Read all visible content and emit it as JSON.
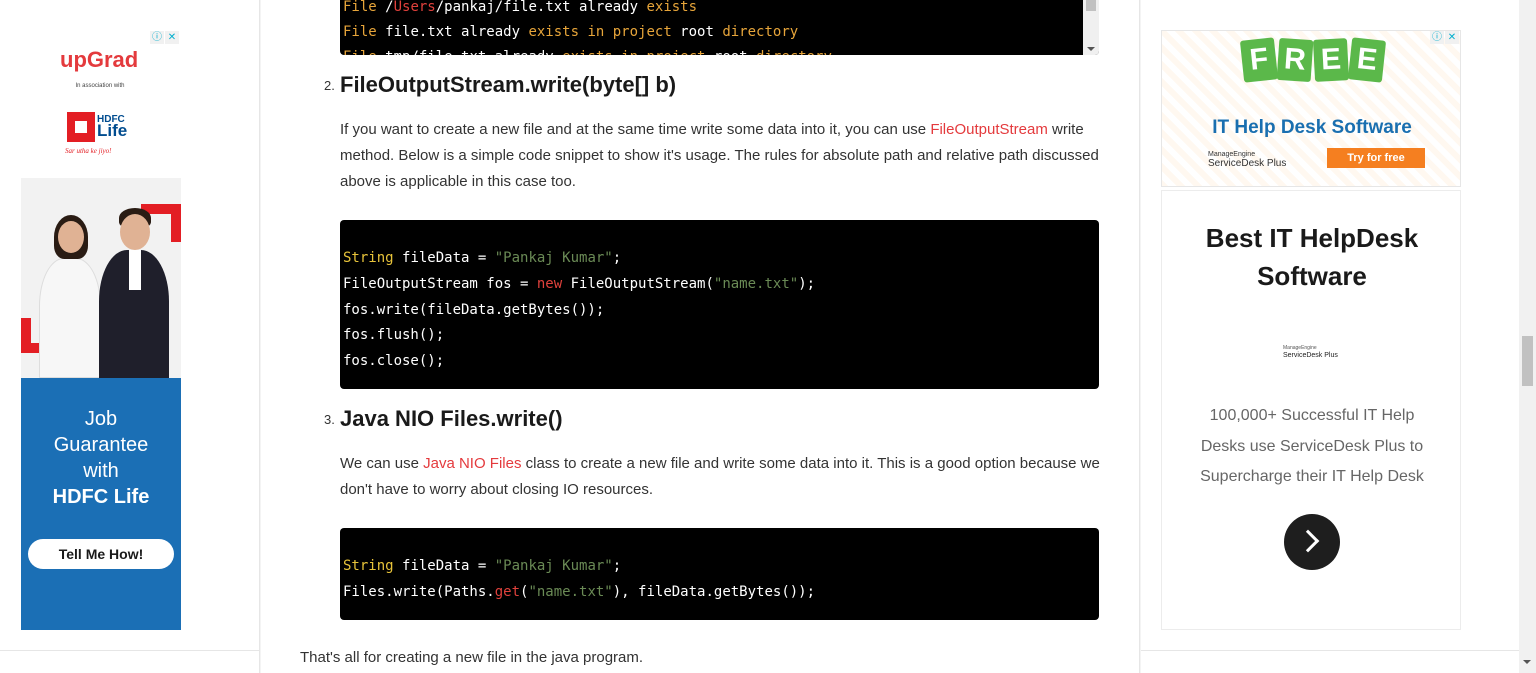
{
  "left_ad": {
    "ad_choices": [
      "ⓘ",
      "✕"
    ],
    "logo": "upGrad",
    "association": "In association with",
    "partner_line1": "HDFC",
    "partner_line2": "Life",
    "tagline": "Sar utha ke jiyo!",
    "banner_line1": "Job",
    "banner_line2": "Guarantee",
    "banner_line3": "with",
    "banner_line4": "HDFC Life",
    "cta": "Tell Me How!",
    "colors": {
      "banner": "#1b6fb5",
      "accent": "#e31e24"
    }
  },
  "article": {
    "code_top_lines": [
      {
        "segments": [
          [
            "File ",
            "k-orange"
          ],
          [
            "/",
            "plain"
          ],
          [
            "Users",
            "k-red"
          ],
          [
            "/pankaj/file.txt already ",
            "plain"
          ],
          [
            "exists",
            "k-orange"
          ]
        ]
      },
      {
        "segments": [
          [
            "File ",
            "k-orange"
          ],
          [
            "file.txt already ",
            "plain"
          ],
          [
            "exists in project ",
            "k-orange"
          ],
          [
            "root ",
            "plain"
          ],
          [
            "directory",
            "k-orange"
          ]
        ]
      },
      {
        "segments": [
          [
            "File ",
            "k-orange"
          ],
          [
            "tmp/file.txt already ",
            "plain"
          ],
          [
            "exists in project ",
            "k-orange"
          ],
          [
            "root ",
            "plain"
          ],
          [
            "directory",
            "k-orange"
          ]
        ]
      }
    ],
    "section2": {
      "number": "2.",
      "title": "FileOutputStream.write(byte[] b)",
      "para_before": "If you want to create a new file and at the same time write some data into it, you can use ",
      "link": "FileOutputStream",
      "para_after": " write method. Below is a simple code snippet to show it's usage. The rules for absolute path and relative path discussed above is applicable in this case too.",
      "code": [
        {
          "segments": [
            [
              "String ",
              "k-yellow"
            ],
            [
              "fileData = ",
              "plain"
            ],
            [
              "\"Pankaj Kumar\"",
              "k-green"
            ],
            [
              ";",
              "plain"
            ]
          ]
        },
        {
          "segments": [
            [
              "FileOutputStream fos = ",
              "plain"
            ],
            [
              "new ",
              "k-red"
            ],
            [
              "FileOutputStream(",
              "plain"
            ],
            [
              "\"name.txt\"",
              "k-green"
            ],
            [
              ");",
              "plain"
            ]
          ]
        },
        {
          "segments": [
            [
              "fos.write(fileData.getBytes());",
              "plain"
            ]
          ]
        },
        {
          "segments": [
            [
              "fos.flush();",
              "plain"
            ]
          ]
        },
        {
          "segments": [
            [
              "fos.close();",
              "plain"
            ]
          ]
        }
      ]
    },
    "section3": {
      "number": "3.",
      "title": "Java NIO Files.write()",
      "para_before": "We can use ",
      "link": "Java NIO Files",
      "para_after": " class to create a new file and write some data into it. This is a good option because we don't have to worry about closing IO resources.",
      "code": [
        {
          "segments": [
            [
              "String ",
              "k-yellow"
            ],
            [
              "fileData = ",
              "plain"
            ],
            [
              "\"Pankaj Kumar\"",
              "k-green"
            ],
            [
              ";",
              "plain"
            ]
          ]
        },
        {
          "segments": [
            [
              "Files.write(Paths.",
              "plain"
            ],
            [
              "get",
              "k-red"
            ],
            [
              "(",
              "plain"
            ],
            [
              "\"name.txt\"",
              "k-green"
            ],
            [
              "), fileData.getBytes());",
              "plain"
            ]
          ]
        }
      ]
    },
    "closing": "That's all for creating a new file in the java program."
  },
  "right_ad": {
    "ad_choices": [
      "ⓘ",
      "✕"
    ],
    "free_letters": [
      "F",
      "R",
      "E",
      "E"
    ],
    "banner_title": "IT Help Desk Software",
    "brand_small": "ManageEngine",
    "brand_big": "ServiceDesk Plus",
    "try_button": "Try for free",
    "card_title_line1": "Best IT HelpDesk",
    "card_title_line2": "Software",
    "card_logo_small": "ManageEngine",
    "card_logo_big": "ServiceDesk Plus",
    "card_desc": "100,000+ Successful IT Help Desks use ServiceDesk Plus to Supercharge their IT Help Desk",
    "colors": {
      "free_tag": "#5bb84a",
      "title_blue": "#1a6fb0",
      "try_orange": "#f57f20"
    }
  }
}
